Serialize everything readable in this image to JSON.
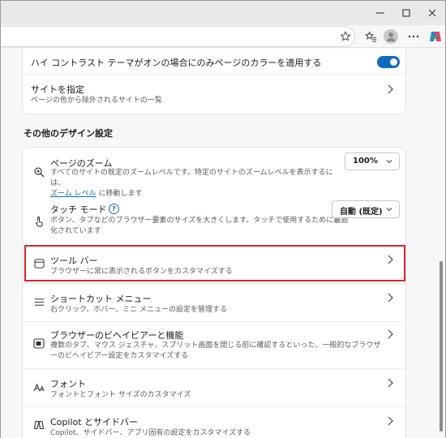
{
  "window": {
    "minimize_glyph": "—",
    "restore_glyph": "☐",
    "close_glyph": "✕"
  },
  "card_top": {
    "high_contrast": {
      "title": "ハイ コントラスト テーマがオンの場合にのみページのカラーを適用する",
      "enabled": true
    },
    "site_designation": {
      "title": "サイトを指定",
      "desc": "ページの色から除外されるサイトの一覧"
    }
  },
  "section": {
    "title": "その他のデザイン設定"
  },
  "items": {
    "zoom": {
      "title": "ページのズーム",
      "desc_line1": "すべてのサイトの既定のズームレベルです。特定のサイトのズームレベルを表示するには、",
      "link": "ズーム レベル",
      "desc_after_link": " に移動します",
      "value": "100%",
      "icon": "zoom-icon"
    },
    "touch": {
      "title": "タッチ モード",
      "help": "?",
      "desc": "ボタン、タブなどのブラウザー要素のサイズを大きくします。タッチで使用するために最適化されています",
      "value": "自動 (既定)",
      "icon": "touch-icon"
    },
    "toolbar": {
      "title": "ツール バー",
      "desc": "ブラウザーに常に表示されるボタンをカスタマイズする",
      "icon": "toolbar-icon"
    },
    "shortcut_menu": {
      "title": "ショートカット メニュー",
      "desc": "右クリック、ホバー、ミニ メニューの設定を管理する",
      "icon": "menu-icon"
    },
    "behavior": {
      "title": "ブラウザーのビヘイビアーと機能",
      "desc": "複数のタブ、マウス ジェスチャ、スプリット画面を閉じる前に確認するといった、一般的なブラウザーのビヘイビアー設定をカスタマイズする",
      "icon": "browser-behavior-icon"
    },
    "font": {
      "title": "フォント",
      "desc": "フォントとフォント サイズのカスタマイズ",
      "icon": "font-icon"
    },
    "copilot": {
      "title": "Copilot とサイドバー",
      "desc": "Copilot、サイドバー、アプリ固有の設定をカスタマイズする",
      "icon": "copilot-icon"
    }
  },
  "colors": {
    "accent": "#0f6cbd",
    "highlight": "#d9262c"
  }
}
